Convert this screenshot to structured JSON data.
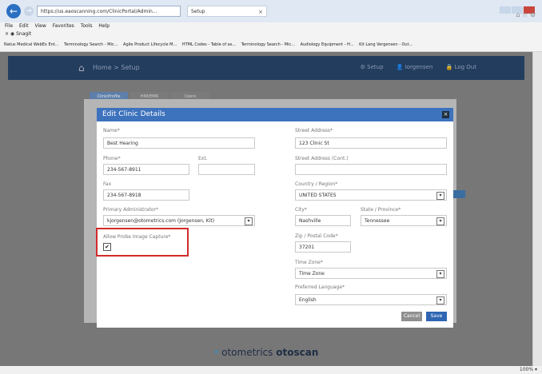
{
  "browser": {
    "back_glyph": "←",
    "forward_glyph": "→",
    "address": "https://us.eaoscanning.com/ClinicPortal/Admin...",
    "address_icons": "ρ ▾ 🔒 C",
    "tab_title": "Setup",
    "tab_close": "×",
    "home_icons": "⌂ ☆ ⚙",
    "menu": [
      "File",
      "Edit",
      "View",
      "Favorites",
      "Tools",
      "Help"
    ],
    "search_toolbar": "× ◉ Snagit",
    "favorites": [
      "Natus Medical WebEx Ent...",
      "Terminology Search - Mic...",
      "Agile Product Lifecycle M...",
      "HTML Codes - Table of as...",
      "Terminology Search - Mic...",
      "Audiology Equipment - H...",
      "Kit Lang Vergensen - Out..."
    ],
    "zoom": "100% ▾"
  },
  "app": {
    "breadcrumb": "Home > Setup",
    "home_icon": "⌂",
    "header_links": [
      "⚙ Setup",
      "👤 Iorgensen",
      "🔒 Log Out"
    ],
    "tabs": [
      "ClinicProfile",
      "HIM/EMR",
      "Users"
    ],
    "logo_mark": "⁍",
    "logo_brand": "otometrics",
    "logo_product": "otoscan"
  },
  "modal": {
    "title": "Edit Clinic Details",
    "close_glyph": "×",
    "name_label": "Name*",
    "name_value": "Best Hearing",
    "phone_label": "Phone*",
    "phone_value": "234-567-8911",
    "ext_label": "Ext.",
    "ext_value": "",
    "fax_label": "Fax",
    "fax_value": "234-567-8918",
    "admin_label": "Primary Administrator*",
    "admin_value": "kjorgensen@otometrics.com (Jorgensen, Kit)",
    "probe_label": "Allow Probe Image Capture*",
    "probe_checked_glyph": "✔",
    "street_label": "Street Address*",
    "street_value": "123 Clinic St",
    "street2_label": "Street Address (Cont.)",
    "street2_value": "",
    "country_label": "Country / Region*",
    "country_value": "UNITED STATES",
    "city_label": "City*",
    "city_value": "Nashville",
    "state_label": "State / Province*",
    "state_value": "Tennessee",
    "zip_label": "Zip / Postal Code*",
    "zip_value": "37201",
    "timezone_label": "Time Zone*",
    "timezone_value": "Time Zone",
    "language_label": "Preferred Language*",
    "language_value": "English",
    "caret_glyph": "▾",
    "cancel_label": "Cancel",
    "save_label": "Save"
  },
  "colors": {
    "modal_header": "#3d72bc",
    "app_bar": "#233d5e",
    "highlight": "#d12b2b",
    "save_button": "#2f66b3",
    "cancel_button": "#8f8f8f"
  }
}
